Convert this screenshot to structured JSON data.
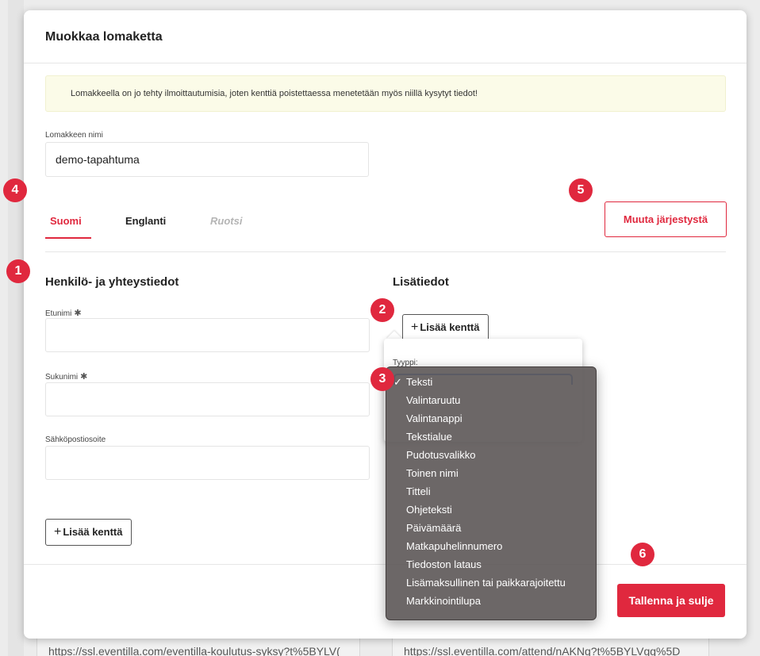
{
  "background": {
    "url_left": "https://ssl.eventilla.com/eventilla-koulutus-syksy?t%5BYLV(",
    "url_right": "https://ssl.eventilla.com/attend/nAKNg?t%5BYLVgg%5D"
  },
  "modal": {
    "title": "Muokkaa lomaketta",
    "warning": "Lomakkeella on jo tehty ilmoittautumisia, joten kenttiä poistettaessa menetetään myös niillä kysytyt tiedot!",
    "form_name_label": "Lomakkeen nimi",
    "form_name_value": "demo-tapahtuma",
    "tabs": [
      {
        "label": "Suomi",
        "state": "active"
      },
      {
        "label": "Englanti",
        "state": "normal"
      },
      {
        "label": "Ruotsi",
        "state": "disabled"
      }
    ],
    "reorder_button": "Muuta järjestystä",
    "left_section": {
      "title": "Henkilö- ja yhteystiedot",
      "fields": [
        {
          "label": "Etunimi",
          "required_mark": "✱"
        },
        {
          "label": "Sukunimi",
          "required_mark": "✱"
        },
        {
          "label": "Sähköpostiosoite",
          "required_mark": ""
        }
      ],
      "add_field_button": "Lisää kenttä"
    },
    "right_section": {
      "title": "Lisätiedot",
      "add_field_button": "Lisää kenttä",
      "type_label": "Tyyppi:"
    },
    "type_options": {
      "selected": "Teksti",
      "items": [
        "Teksti",
        "Valintaruutu",
        "Valintanappi",
        "Tekstialue",
        "Pudotusvalikko",
        "Toinen nimi",
        "Titteli",
        "Ohjeteksti",
        "Päivämäärä",
        "Matkapuhelinnumero",
        "Tiedoston lataus",
        "Lisämaksullinen tai paikkarajoitettu",
        "Markkinointilupa"
      ]
    },
    "save_button": "Tallenna ja sulje"
  },
  "markers": [
    "1",
    "2",
    "3",
    "4",
    "5",
    "6"
  ],
  "colors": {
    "accent": "#e0283e",
    "warning_bg": "#fbfbe8",
    "focus": "#2a67d8"
  }
}
